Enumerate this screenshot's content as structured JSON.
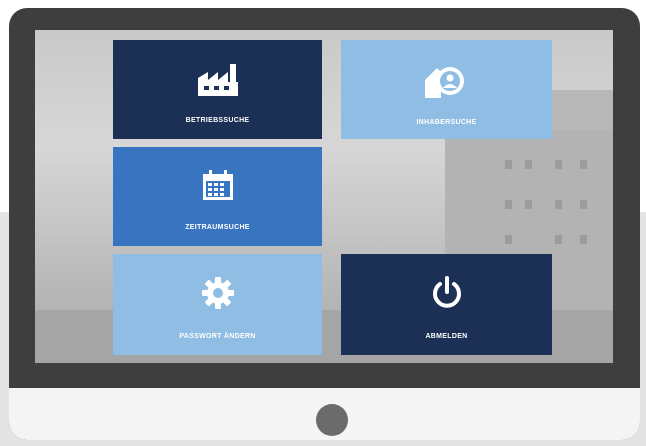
{
  "tiles": {
    "betriebssuche": {
      "label": "BETRIEBSSUCHE",
      "icon": "factory-icon",
      "color": "#1c2f55"
    },
    "inhabersuche": {
      "label": "INHABERSUCHE",
      "icon": "owner-badge-icon",
      "color": "#8fbde3"
    },
    "zeitraumsuche": {
      "label": "ZEITRAUMSUCHE",
      "icon": "calendar-icon",
      "color": "#3874c0"
    },
    "passwort": {
      "label": "PASSWORT ÄNDERN",
      "icon": "gear-icon",
      "color": "#8fbde3"
    },
    "abmelden": {
      "label": "ABMELDEN",
      "icon": "power-icon",
      "color": "#1c2f55"
    }
  }
}
